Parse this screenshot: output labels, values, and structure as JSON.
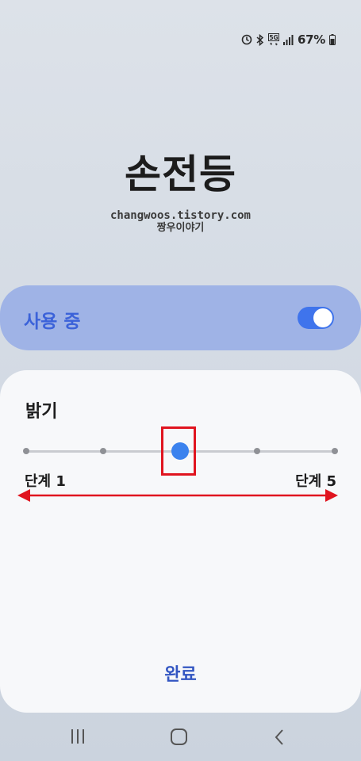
{
  "status_bar": {
    "battery_percent": "67%",
    "icons": [
      "data-saver-icon",
      "bluetooth-icon",
      "5g-icon",
      "signal-icon",
      "battery-icon"
    ]
  },
  "header": {
    "title": "손전등",
    "watermark_line1": "changwoos.tistory.com",
    "watermark_line2": "짱우이야기"
  },
  "toggle": {
    "label": "사용 중",
    "on": true,
    "accent_color": "#3f74ec"
  },
  "brightness": {
    "title": "밝기",
    "min_label": "단계 1",
    "max_label": "단계 5",
    "levels": 5,
    "current_level": 3,
    "annotation_color": "#e0141f"
  },
  "actions": {
    "done_label": "완료"
  },
  "nav_bar": {
    "icons": [
      "recent-apps-icon",
      "home-icon",
      "back-icon"
    ]
  }
}
